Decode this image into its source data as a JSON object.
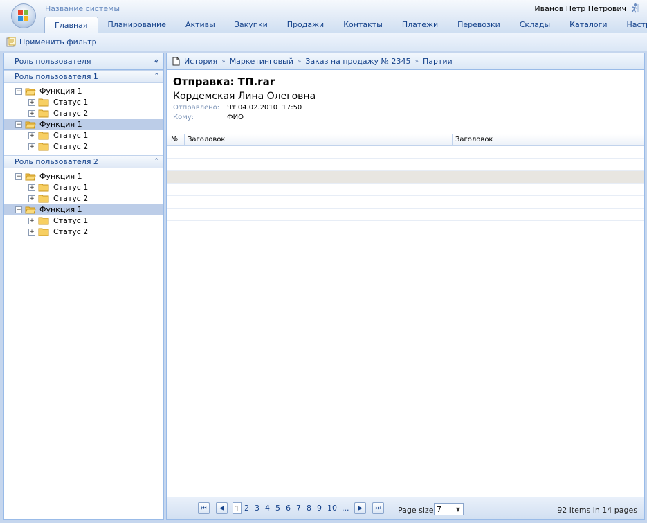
{
  "app": {
    "system_name": "Название системы",
    "user_name": "Иванов Петр Петрович"
  },
  "tabs": [
    {
      "label": "Главная",
      "active": true
    },
    {
      "label": "Планирование"
    },
    {
      "label": "Активы"
    },
    {
      "label": "Закупки"
    },
    {
      "label": "Продажи"
    },
    {
      "label": "Контакты"
    },
    {
      "label": "Платежи"
    },
    {
      "label": "Перевозки"
    },
    {
      "label": "Склады"
    },
    {
      "label": "Каталоги"
    },
    {
      "label": "Настройки"
    }
  ],
  "toolbar": {
    "apply_filter": "Применить фильтр"
  },
  "sidebar": {
    "title": "Роль пользователя",
    "collapse_icon": "«",
    "groups": [
      {
        "title": "Роль пользователя 1",
        "nodes": [
          {
            "label": "Функция 1",
            "children": [
              "Статус 1",
              "Статус 2"
            ]
          },
          {
            "label": "Функция 1",
            "children": [
              "Статус 1",
              "Статус 2"
            ],
            "selected": true
          }
        ]
      },
      {
        "title": "Роль пользователя 2",
        "nodes": [
          {
            "label": "Функция 1",
            "children": [
              "Статус 1",
              "Статус 2"
            ]
          },
          {
            "label": "Функция 1",
            "children": [
              "Статус 1",
              "Статус 2"
            ],
            "selected": true
          }
        ]
      }
    ]
  },
  "breadcrumb": [
    "История",
    "Маркетинговый",
    "Заказ на продажу № 2345",
    "Партии"
  ],
  "details": {
    "title": "Отправка: ТП.rar",
    "name": "Кордемская Лина Олеговна",
    "sent_label": "Отправлено:",
    "sent_value": "Чт 04.02.2010  17:50",
    "to_label": "Кому:",
    "to_value": "ФИО"
  },
  "grid": {
    "columns": [
      "№",
      "Заголовок",
      "Заголовок"
    ]
  },
  "pager": {
    "pages": [
      "1",
      "2",
      "3",
      "4",
      "5",
      "6",
      "7",
      "8",
      "9",
      "10",
      "..."
    ],
    "current_page": "1",
    "page_size_label": "Page size:",
    "page_size": "7",
    "info": "92 items in 14 pages"
  },
  "colors": {
    "accent": "#15428b",
    "border": "#99bbe8",
    "selected_row": "#bccde8"
  }
}
